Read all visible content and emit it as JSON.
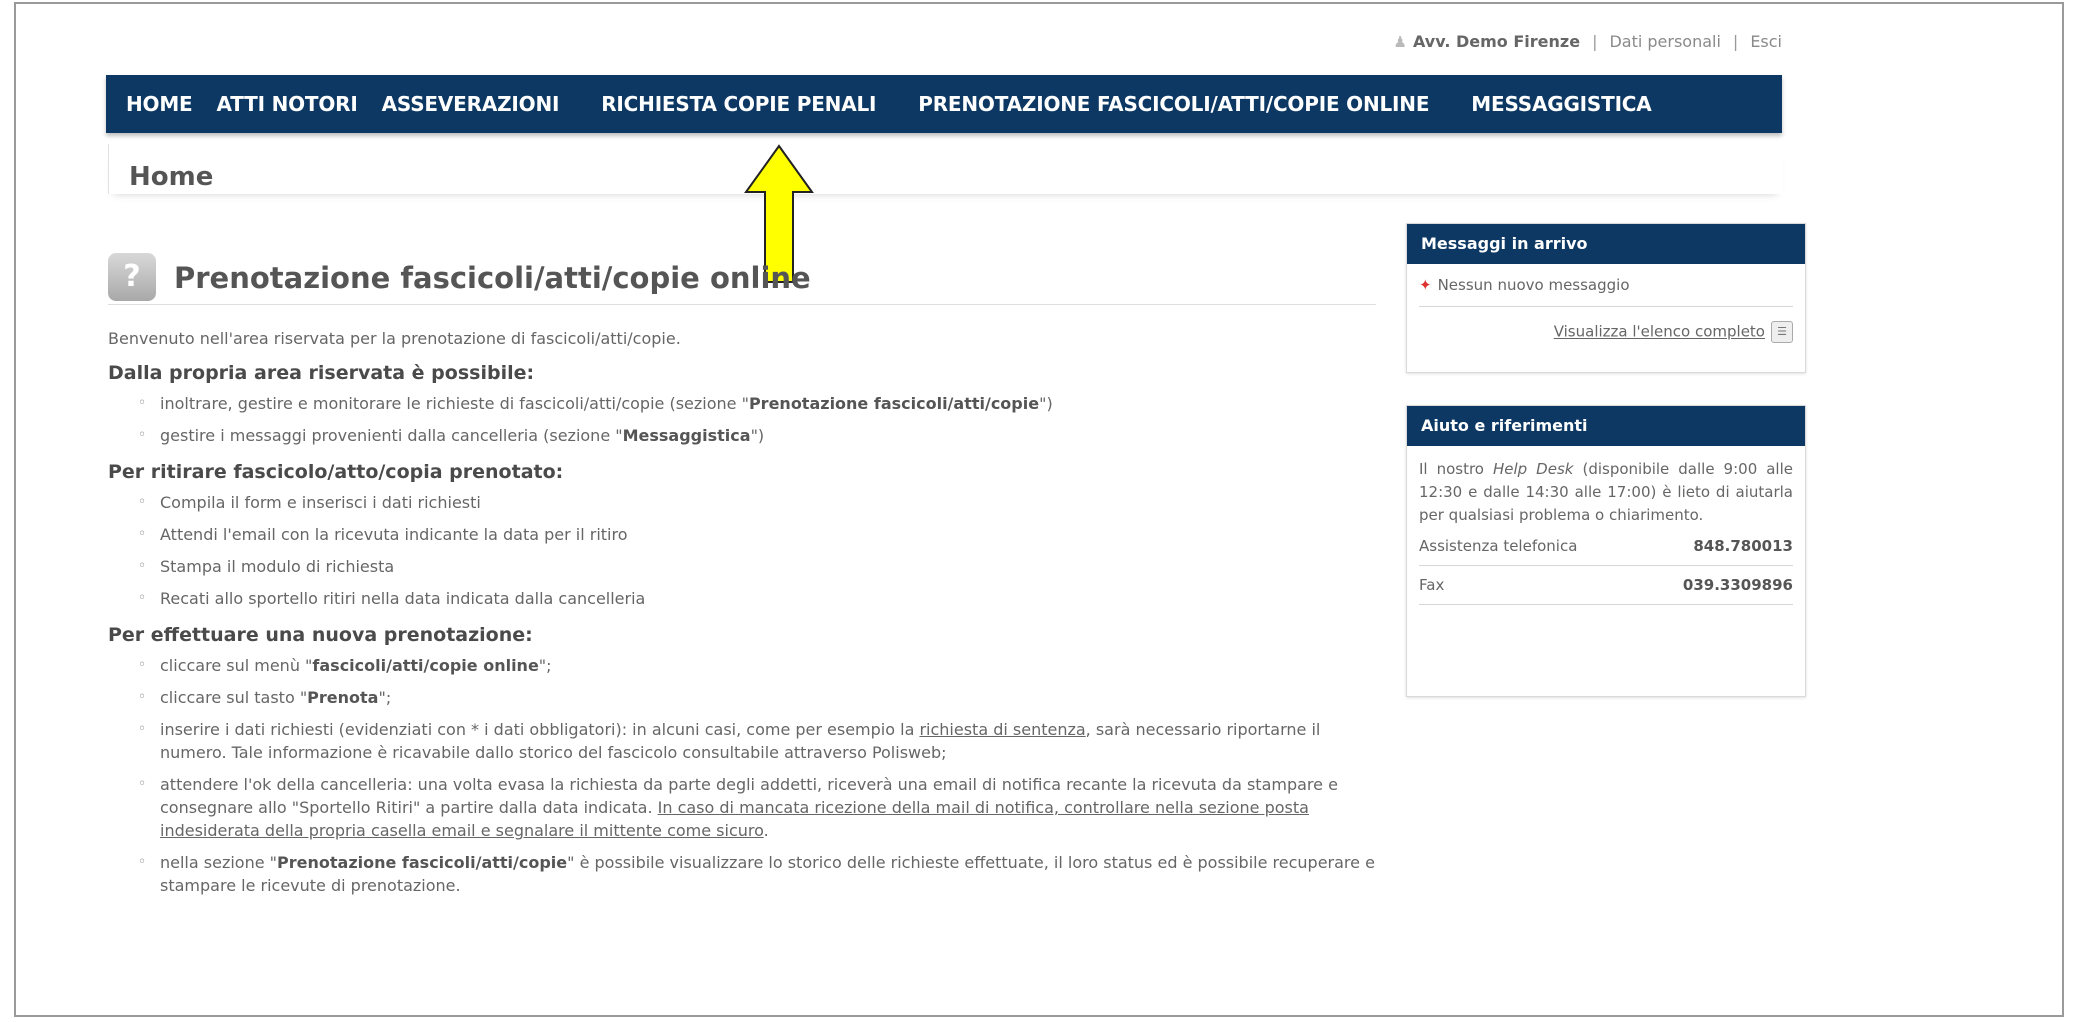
{
  "topbar": {
    "user": "Avv. Demo Firenze",
    "sep1": "|",
    "personal_data": "Dati personali",
    "sep2": "|",
    "logout": "Esci",
    "user_icon": "user-icon"
  },
  "nav": {
    "items": [
      "HOME",
      "ATTI NOTORI",
      "ASSEVERAZIONI",
      "RICHIESTA COPIE PENALI",
      "PRENOTAZIONE FASCICOLI/ATTI/COPIE ONLINE",
      "MESSAGGISTICA"
    ]
  },
  "breadcrumb": "Home",
  "annotation": {
    "arrow_color": "#ffff00",
    "icon": "arrow-up-icon"
  },
  "main": {
    "title": "Prenotazione fascicoli/atti/copie online",
    "intro": "Benvenuto nell'area riservata per la prenotazione di fascicoli/atti/copie.",
    "section1": {
      "heading": "Dalla propria area riservata è possibile:",
      "items": [
        {
          "pre": "inoltrare, gestire e monitorare le richieste di fascicoli/atti/copie (sezione \"",
          "bold": "Prenotazione fascicoli/atti/copie",
          "post": "\")"
        },
        {
          "pre": "gestire i messaggi provenienti dalla cancelleria (sezione \"",
          "bold": "Messaggistica",
          "post": "\")"
        }
      ]
    },
    "section2": {
      "heading": "Per ritirare fascicolo/atto/copia prenotato:",
      "items": [
        "Compila il form e inserisci i dati richiesti",
        "Attendi l'email con la ricevuta indicante la data per il ritiro",
        "Stampa il modulo di richiesta",
        "Recati allo sportello ritiri nella data indicata dalla cancelleria"
      ]
    },
    "section3": {
      "heading": "Per effettuare una nuova prenotazione:",
      "item1": {
        "pre": "cliccare sul menù \"",
        "bold": "fascicoli/atti/copie online",
        "post": "\";"
      },
      "item2": {
        "pre": "cliccare sul tasto \"",
        "bold": "Prenota",
        "post": "\";"
      },
      "item3": {
        "pre": "inserire i dati richiesti (evidenziati con * i dati obbligatori): in alcuni casi, come per esempio la ",
        "link": "richiesta di sentenza",
        "post": ", sarà necessario riportarne il numero. Tale informazione è ricavabile dallo storico del fascicolo consultabile attraverso Polisweb;"
      },
      "item4": {
        "pre": "attendere l'ok della cancelleria: una volta evasa la richiesta da parte degli addetti, riceverà una email di notifica recante la ricevuta da stampare e consegnare allo \"Sportello Ritiri\" a partire dalla data indicata. ",
        "link": "In caso di mancata ricezione della mail di notifica, controllare nella sezione posta indesiderata della propria casella email e segnalare il mittente come sicuro",
        "post": "."
      },
      "item5": {
        "pre": "nella sezione \"",
        "bold": "Prenotazione fascicoli/atti/copie",
        "post": "\" è possibile visualizzare lo storico delle richieste effettuate, il loro status ed è possibile recuperare e stampare le ricevute di prenotazione."
      }
    }
  },
  "messages_box": {
    "title": "Messaggi in arrivo",
    "no_messages": "Nessun nuovo messaggio",
    "view_all": "Visualizza l'elenco completo",
    "pin_icon": "pin-icon",
    "list_icon": "list-icon"
  },
  "help_box": {
    "title": "Aiuto e riferimenti",
    "text_pre": "Il nostro ",
    "text_italic": "Help Desk",
    "text_post": " (disponibile dalle 9:00 alle 12:30 e dalle 14:30 alle 17:00) è lieto di aiutarla per qualsiasi problema o chiarimento.",
    "phone_label": "Assistenza telefonica",
    "phone_value": "848.780013",
    "fax_label": "Fax",
    "fax_value": "039.3309896"
  },
  "colors": {
    "nav_bg": "#0c3863",
    "arrow": "#ffff00"
  }
}
